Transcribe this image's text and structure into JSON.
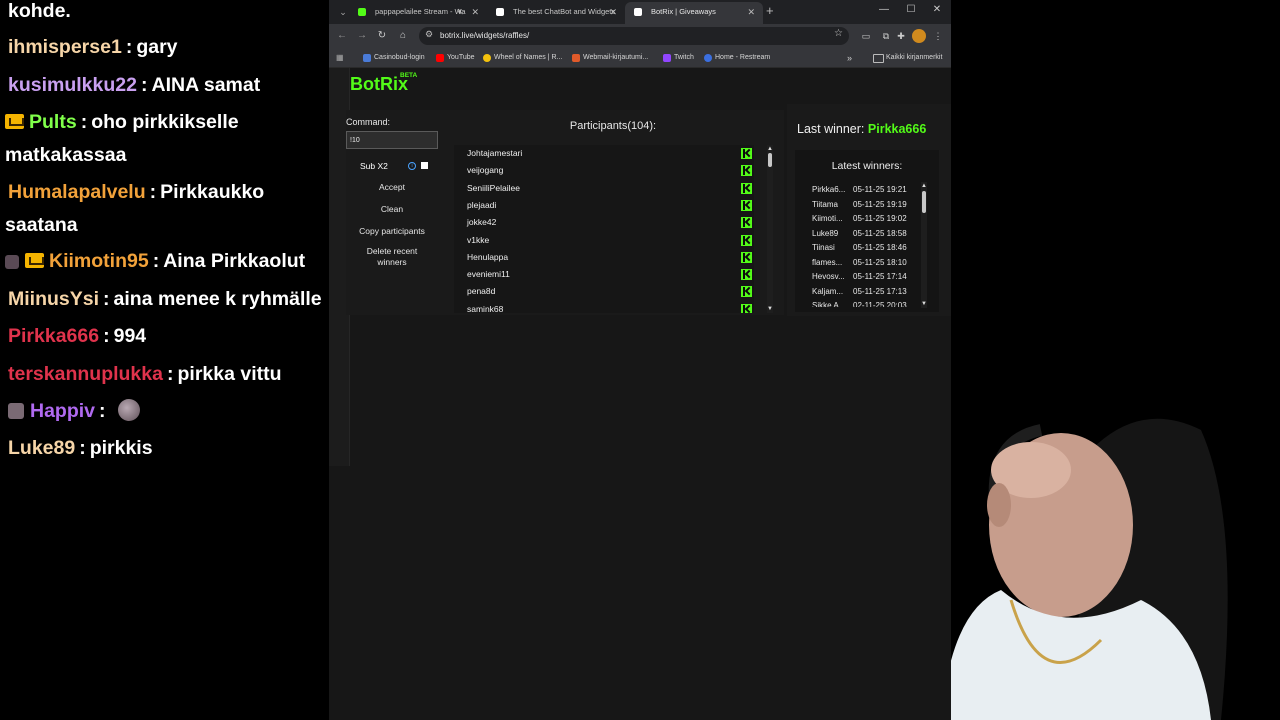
{
  "chat": {
    "lines": [
      {
        "user": "",
        "message": "kohde.",
        "user_color": "#ffffff"
      },
      {
        "user": "ihmisperse1",
        "message": "gary",
        "user_color": "#f6d5a8"
      },
      {
        "user": "kusimulkku22",
        "message": "AINA samat",
        "user_color": "#c9a0f0"
      },
      {
        "user": "Pults",
        "message": "oho pirkkikselle",
        "user_color": "#80ff4a",
        "badge": "crown-icon"
      },
      {
        "user": "",
        "message": "matkakassaa",
        "user_color": "#ffffff"
      },
      {
        "user": "Humalapalvelu",
        "message": "Pirkkaukko",
        "user_color": "#f2a23a"
      },
      {
        "user": "",
        "message": "saatana",
        "user_color": "#ffffff"
      },
      {
        "user": "Kiimotin95",
        "message": "Aina Pirkkaolut",
        "user_color": "#f2a23a",
        "badge": "crown-icon"
      },
      {
        "user": "MiinusYsi",
        "message": "aina menee k ryhmälle",
        "user_color": "#f6d5a8"
      },
      {
        "user": "Pirkka666",
        "message": "994",
        "user_color": "#e0334c"
      },
      {
        "user": "terskannuplukka",
        "message": "pirkka vittu",
        "user_color": "#e0334c"
      },
      {
        "user": "Happiv",
        "message": "",
        "user_color": "#b06af0"
      },
      {
        "user": "Luke89",
        "message": "pirkkis",
        "user_color": "#f6d5a8"
      }
    ],
    "separator": ":"
  },
  "browser": {
    "tabs": [
      {
        "title": "pappapelailee Stream - Wa",
        "favicon_color": "#53fc18",
        "active": false
      },
      {
        "title": "The best ChatBot and Widgets",
        "favicon_color": "#ffffff",
        "active": false
      },
      {
        "title": "BotRix | Giveaways",
        "favicon_color": "#ffffff",
        "active": true
      }
    ],
    "new_tab": "+",
    "url": "botrix.live/widgets/raffles/",
    "bookmarks": [
      {
        "label": "Casinobud-login",
        "color": "#4a7bd8"
      },
      {
        "label": "YouTube",
        "color": "#ff0000"
      },
      {
        "label": "Wheel of Names | R...",
        "color": "#f4c20d"
      },
      {
        "label": "Webmail-kirjautumi...",
        "color": "#e05a2a"
      },
      {
        "label": "Twitch",
        "color": "#9146ff"
      },
      {
        "label": "Home - Restream",
        "color": "#3b6fe0"
      }
    ],
    "bookmarks_folder": "Kaikki kirjanmerkit"
  },
  "app": {
    "brand": "BotRix",
    "brand_badge": "BETA",
    "brand_color": "#53fc18",
    "command_label": "Command:",
    "command_value": "!10",
    "sub_label": "Sub X2",
    "buttons": {
      "accept": "Accept",
      "clean": "Clean",
      "copy": "Copy participants",
      "delete_recent": "Delete recent winners"
    },
    "participants_title": "Participants(104):",
    "participants": [
      "Johtajamestari",
      "veijogang",
      "SeniiliPelailee",
      "plejaadi",
      "jokke42",
      "v1kke",
      "Henulappa",
      "eveniemi11",
      "pena8d",
      "samink68"
    ],
    "last_winner_label": "Last winner:",
    "last_winner": "Pirkka666",
    "latest_winners_title": "Latest winners:",
    "latest_winners": [
      {
        "name": "Pirkka6...",
        "date": "05-11-25 19:21"
      },
      {
        "name": "Tiitama",
        "date": "05-11-25 19:19"
      },
      {
        "name": "Kiimoti...",
        "date": "05-11-25 19:02"
      },
      {
        "name": "Luke89",
        "date": "05-11-25 18:58"
      },
      {
        "name": "Tiinasi",
        "date": "05-11-25 18:46"
      },
      {
        "name": "flames...",
        "date": "05-11-25 18:10"
      },
      {
        "name": "Hevosv...",
        "date": "05-11-25 17:14"
      },
      {
        "name": "Kaljam...",
        "date": "05-11-25 17:13"
      },
      {
        "name": "Sikke A...",
        "date": "02-11-25 20:03"
      }
    ]
  }
}
